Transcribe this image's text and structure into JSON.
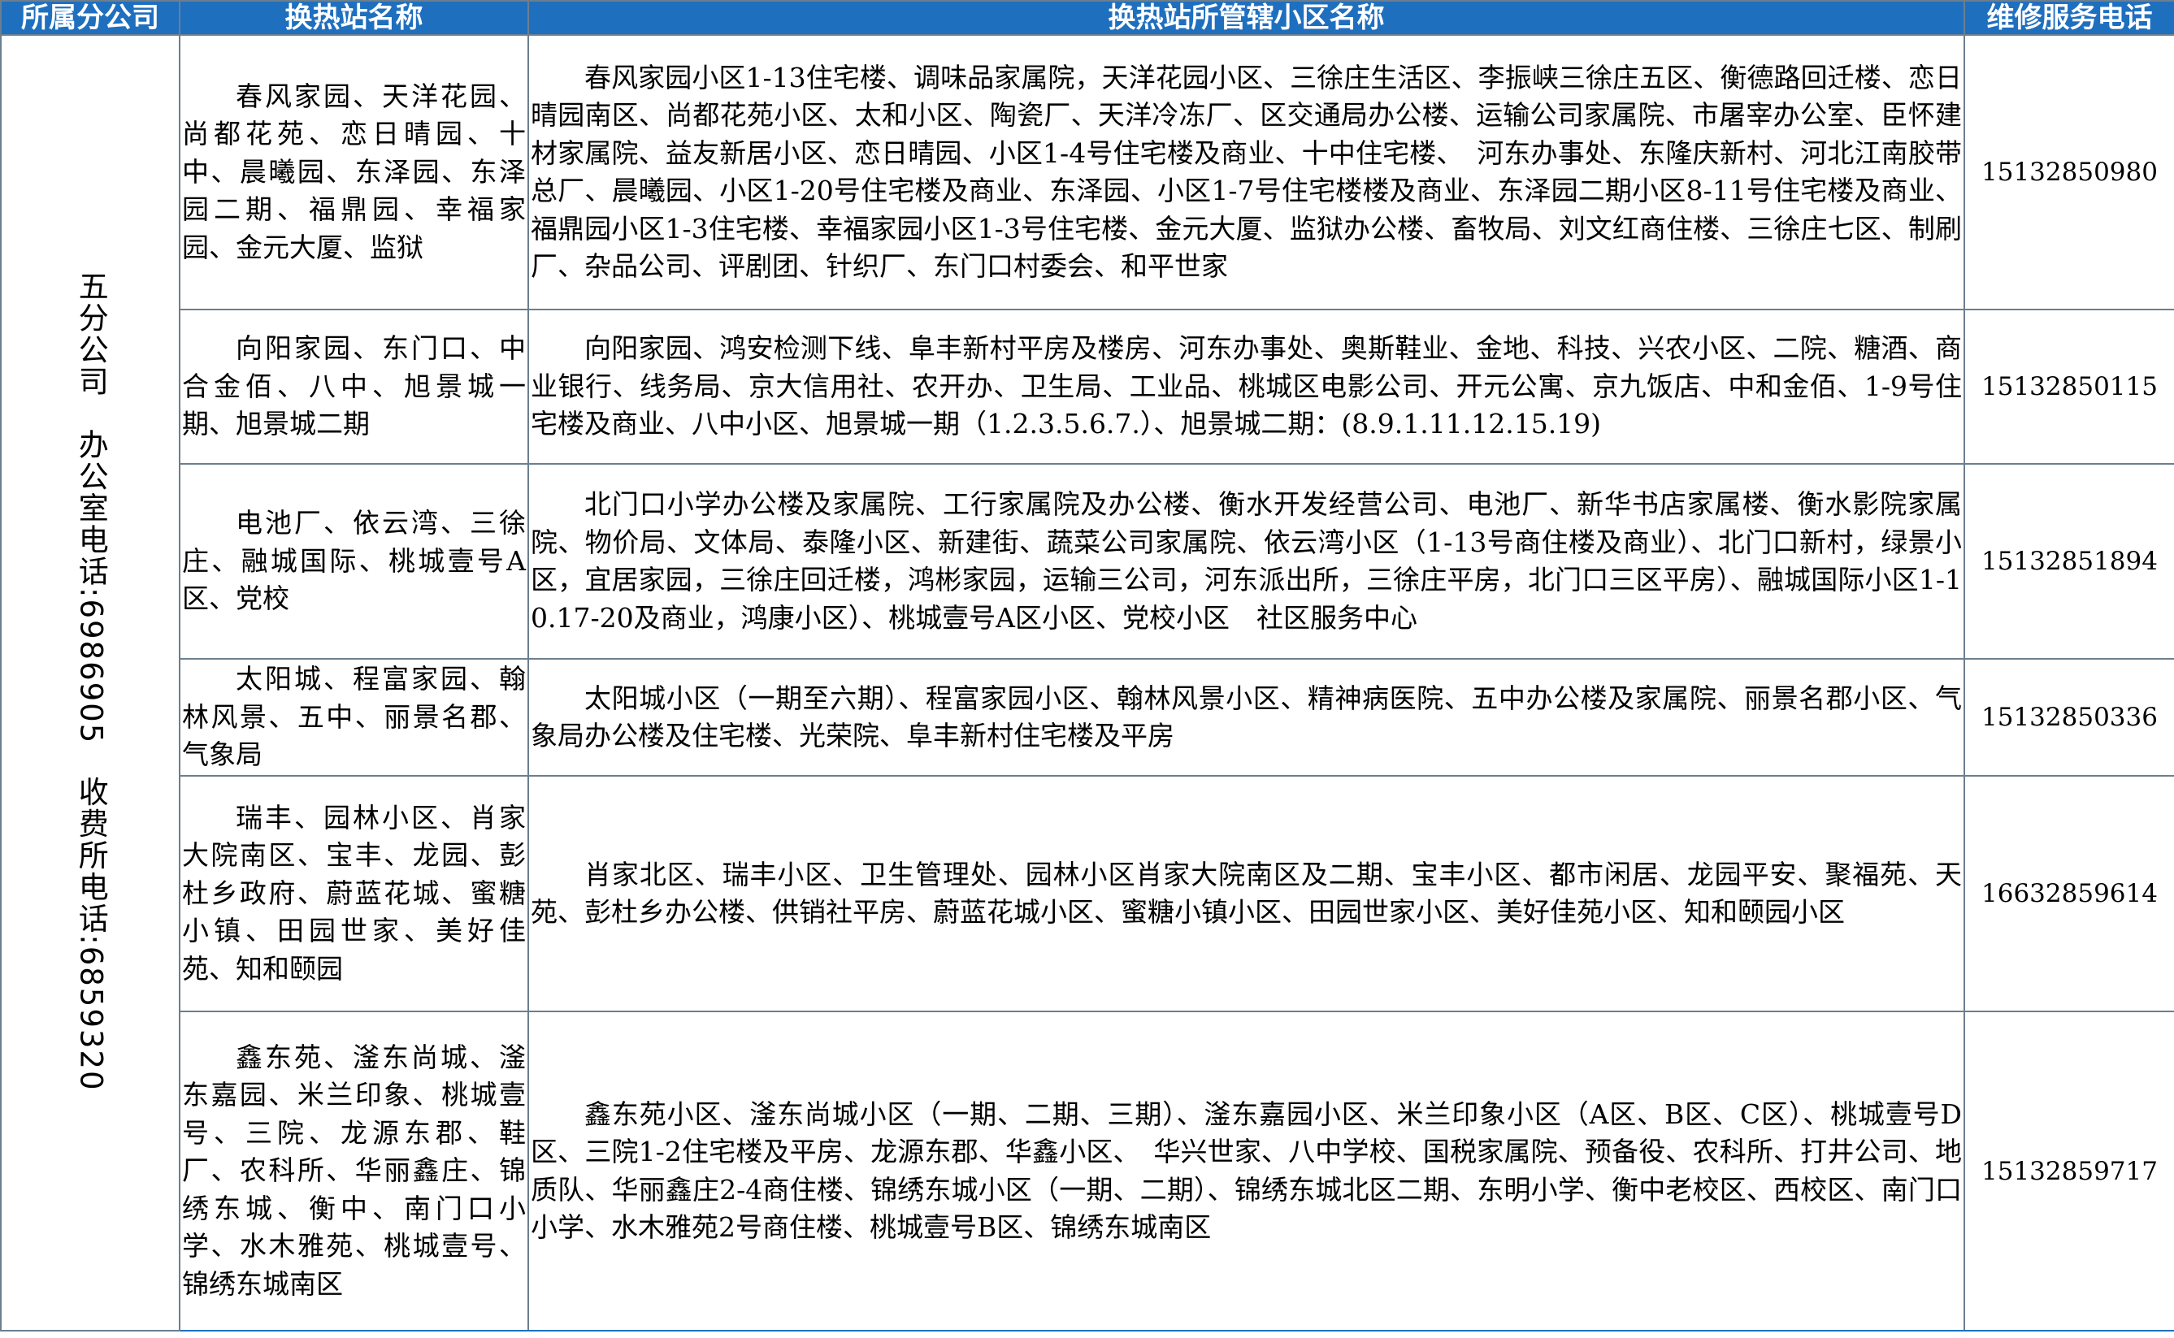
{
  "table": {
    "headers": [
      "所属分公司",
      "换热站名称",
      "换热站所管辖小区名称",
      "维修服务电话"
    ],
    "branch": {
      "name": "五分公司",
      "office_phone": "办公室电话:6986905",
      "fee_phone": "收费所电话:6859320"
    },
    "rows": [
      {
        "station": "春风家园、天洋花园、尚都花苑、恋日晴园、十中、晨曦园、东泽园、东泽园二期、福鼎园、幸福家园、金元大厦、监狱",
        "communities": "春风家园小区1-13住宅楼、调味品家属院，天洋花园小区、三徐庄生活区、李振峡三徐庄五区、衡德路回迁楼、恋日晴园南区、尚都花苑小区、太和小区、陶瓷厂、天洋冷冻厂、区交通局办公楼、运输公司家属院、市屠宰办公室、臣怀建材家属院、益友新居小区、恋日晴园、小区1-4号住宅楼及商业、十中住宅楼、　河东办事处、东隆庆新村、河北江南胶带总厂、晨曦园、小区1-20号住宅楼及商业、东泽园、小区1-7号住宅楼楼及商业、东泽园二期小区8-11号住宅楼及商业、福鼎园小区1-3住宅楼、幸福家园小区1-3号住宅楼、金元大厦、监狱办公楼、畜牧局、刘文红商住楼、三徐庄七区、制刷厂、杂品公司、评剧团、针织厂、东门口村委会、和平世家",
        "phone": "15132850980"
      },
      {
        "station": "向阳家园、东门口、中合金佰、八中、旭景城一期、旭景城二期",
        "communities": "向阳家园、鸿安检测下线、阜丰新村平房及楼房、河东办事处、奥斯鞋业、金地、科技、兴农小区、二院、糖酒、商业银行、线务局、京大信用社、农开办、卫生局、工业品、桃城区电影公司、开元公寓、京九饭店、中和金佰、1-9号住宅楼及商业、八中小区、旭景城一期（1.2.3.5.6.7.）、旭景城二期：(8.9.1.11.12.15.19)",
        "phone": "15132850115"
      },
      {
        "station": "电池厂、依云湾、三徐庄、融城国际、桃城壹号A区、党校",
        "communities": "北门口小学办公楼及家属院、工行家属院及办公楼、衡水开发经营公司、电池厂、新华书店家属楼、衡水影院家属院、物价局、文体局、泰隆小区、新建街、蔬菜公司家属院、依云湾小区（1-13号商住楼及商业）、北门口新村，绿景小区，宜居家园，三徐庄回迁楼，鸿彬家园，运输三公司，河东派出所，三徐庄平房，北门口三区平房）、融城国际小区1-10.17-20及商业，鸿康小区）、桃城壹号A区小区、党校小区　社区服务中心",
        "phone": "15132851894"
      },
      {
        "station": "太阳城、程富家园、翰林风景、五中、丽景名郡、气象局",
        "communities": "太阳城小区（一期至六期）、程富家园小区、翰林风景小区、精神病医院、五中办公楼及家属院、丽景名郡小区、气象局办公楼及住宅楼、光荣院、阜丰新村住宅楼及平房",
        "phone": "15132850336"
      },
      {
        "station": "瑞丰、园林小区、肖家大院南区、宝丰、龙园、彭杜乡政府、蔚蓝花城、蜜糖小镇、田园世家、美好佳苑、知和颐园",
        "communities": "肖家北区、瑞丰小区、卫生管理处、园林小区肖家大院南区及二期、宝丰小区、都市闲居、龙园平安、聚福苑、天苑、彭杜乡办公楼、供销社平房、蔚蓝花城小区、蜜糖小镇小区、田园世家小区、美好佳苑小区、知和颐园小区",
        "phone": "16632859614"
      },
      {
        "station": "鑫东苑、滏东尚城、滏东嘉园、米兰印象、桃城壹号、三院、龙源东郡、鞋厂、农科所、华丽鑫庄、锦绣东城、衡中、南门口小学、水木雅苑、桃城壹号、锦绣东城南区",
        "communities": "鑫东苑小区、滏东尚城小区（一期、二期、三期）、滏东嘉园小区、米兰印象小区（A区、B区、C区）、桃城壹号D区、三院1-2住宅楼及平房、龙源东郡、华鑫小区、　华兴世家、八中学校、国税家属院、预备役、农科所、打井公司、地质队、华丽鑫庄2-4商住楼、锦绣东城小区（一期、二期）、锦绣东城北区二期、东明小学、衡中老校区、西校区、南门口小学、水木雅苑2号商住楼、桃城壹号B区、锦绣东城南区",
        "phone": "15132859717"
      }
    ]
  }
}
